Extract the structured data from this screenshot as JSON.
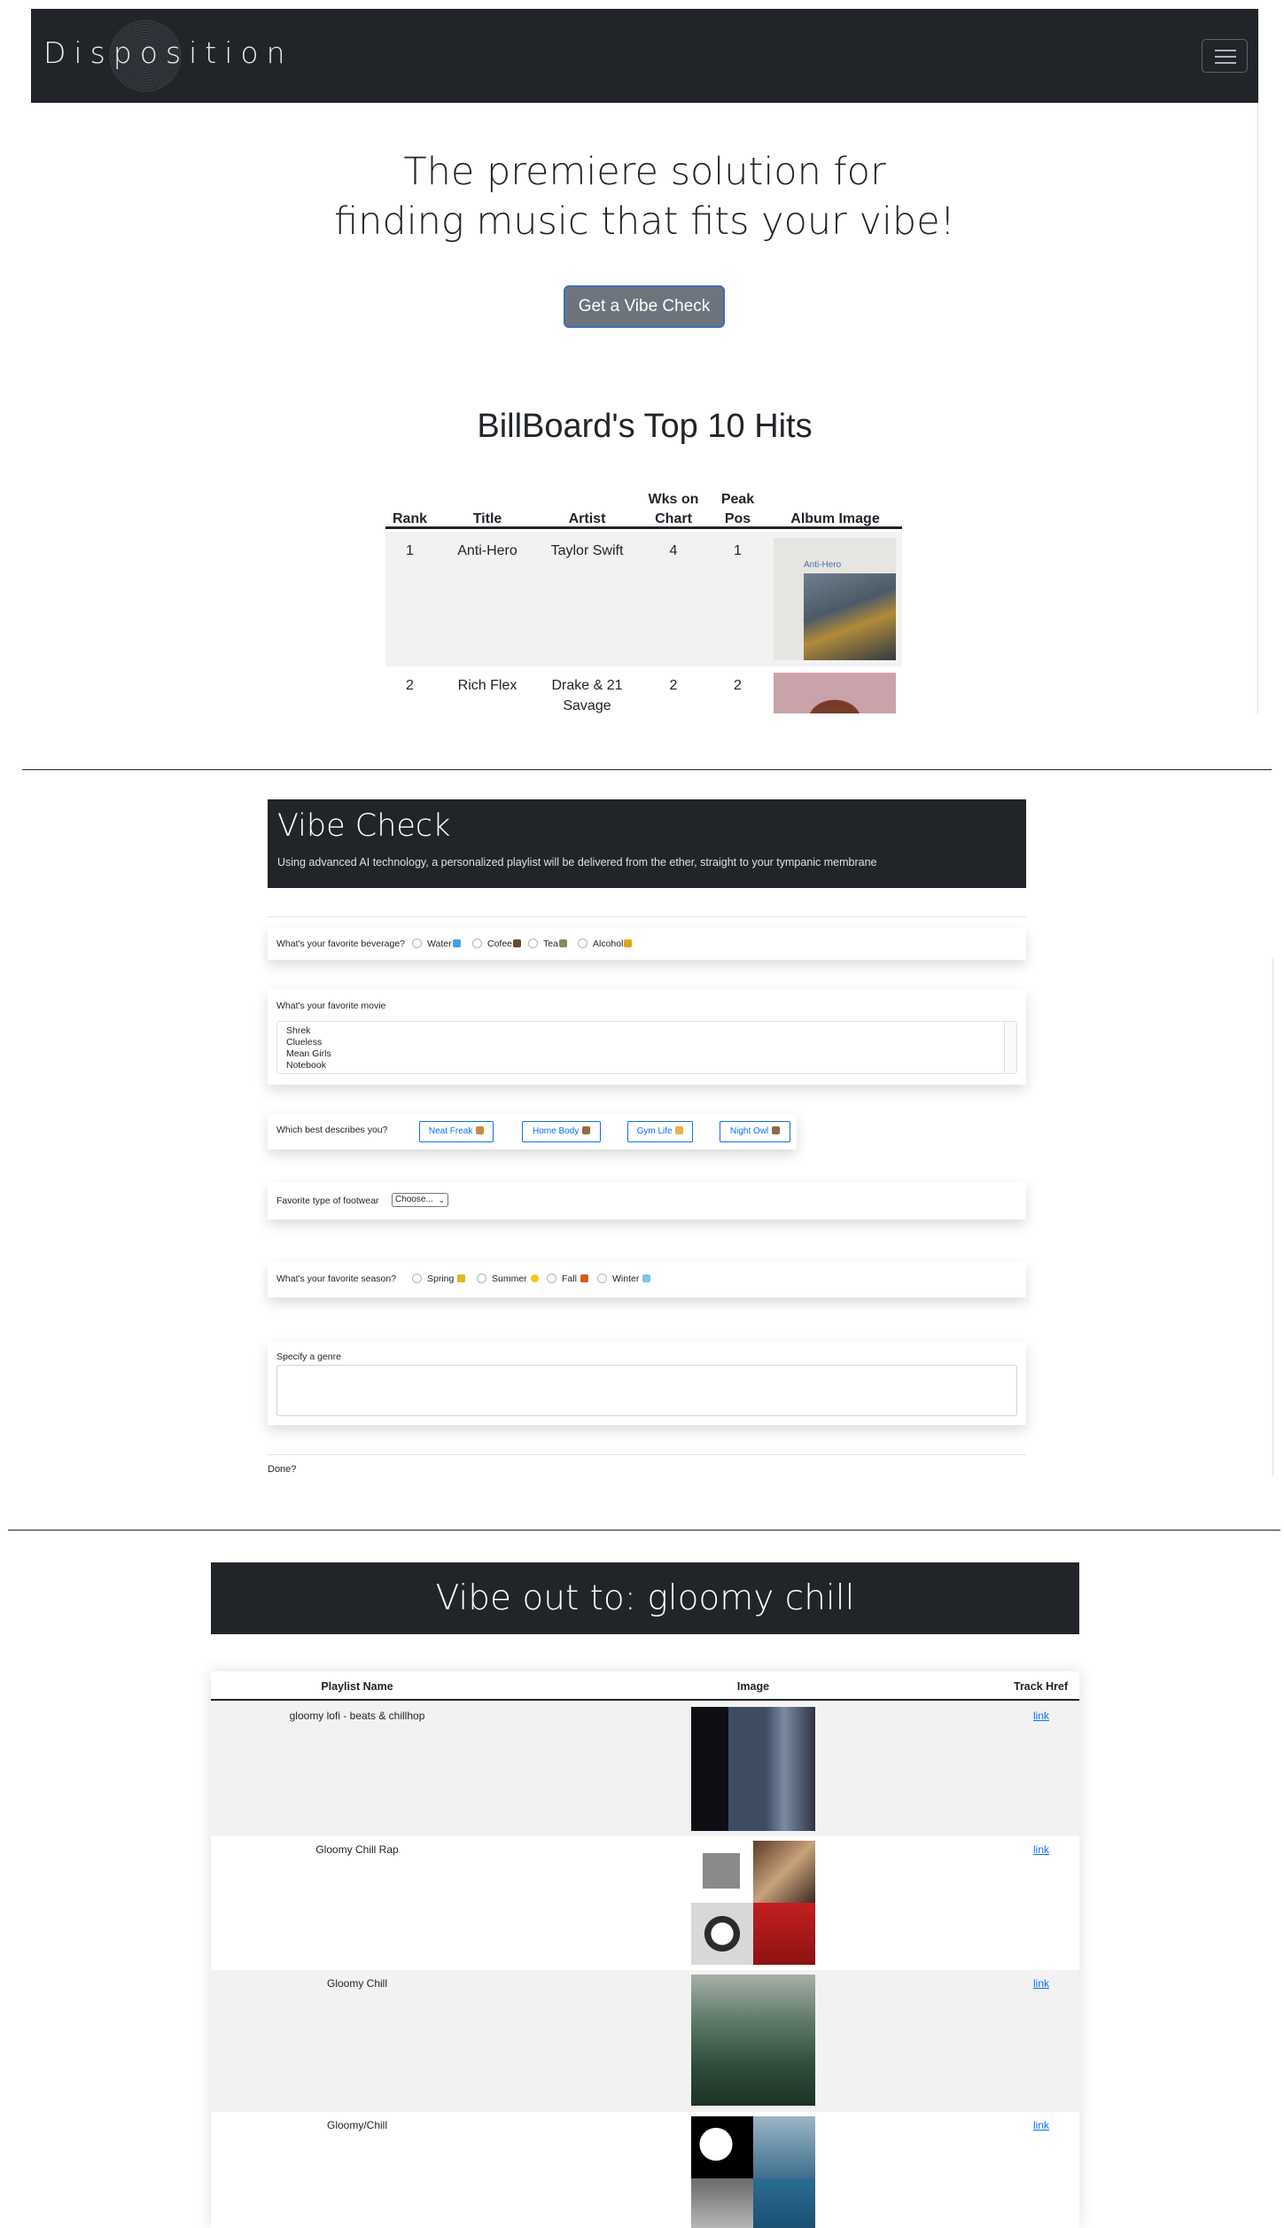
{
  "nav": {
    "brand": "Disposition",
    "toggle_icon": "hamburger-icon"
  },
  "hero": {
    "line1": "The premiere solution for",
    "line2": "finding music that fits your vibe!",
    "button": "Get a Vibe Check"
  },
  "billboard": {
    "title": "BillBoard's Top 10 Hits",
    "columns": {
      "rank": "Rank",
      "title": "Title",
      "artist": "Artist",
      "wks_line1": "Wks on",
      "wks_line2": "Chart",
      "peak_line1": "Peak",
      "peak_line2": "Pos",
      "album": "Album Image"
    },
    "rows": [
      {
        "rank": "1",
        "title": "Anti-Hero",
        "artist": "Taylor Swift",
        "wks": "4",
        "peak": "1",
        "album_text": "Anti-Hero"
      },
      {
        "rank": "2",
        "title": "Rich Flex",
        "artist_line1": "Drake & 21",
        "artist_line2": "Savage",
        "wks": "2",
        "peak": "2"
      }
    ]
  },
  "vibe_check": {
    "title": "Vibe Check",
    "subtitle": "Using advanced AI technology, a personalized playlist will be delivered from the ether, straight to your tympanic membrane",
    "beverage": {
      "question": "What's your favorite beverage?",
      "options": [
        "Water",
        "Cofee",
        "Tea",
        "Alcohol"
      ]
    },
    "movie": {
      "question": "What's your favorite movie",
      "options": [
        "Shrek",
        "Clueless",
        "Mean Girls",
        "Notebook"
      ]
    },
    "describe": {
      "question": "Which best describes you?",
      "options": [
        "Neat Freak",
        "Home Body",
        "Gym Life",
        "Night Owl"
      ]
    },
    "footwear": {
      "question": "Favorite type of footwear",
      "selected": "Choose..."
    },
    "season": {
      "question": "What's your favorite season?",
      "options": [
        "Spring",
        "Summer",
        "Fall",
        "Winter"
      ]
    },
    "genre": {
      "label": "Specify a genre",
      "value": ""
    },
    "done": "Done?"
  },
  "playlist": {
    "heading": "Vibe out to: gloomy chill",
    "columns": {
      "name": "Playlist Name",
      "image": "Image",
      "href": "Track Href"
    },
    "rows": [
      {
        "name": "gloomy lofi - beats & chillhop",
        "link": "link"
      },
      {
        "name": "Gloomy Chill Rap",
        "link": "link"
      },
      {
        "name": "Gloomy Chill",
        "link": "link"
      },
      {
        "name": "Gloomy/Chill",
        "link": "link"
      }
    ]
  }
}
